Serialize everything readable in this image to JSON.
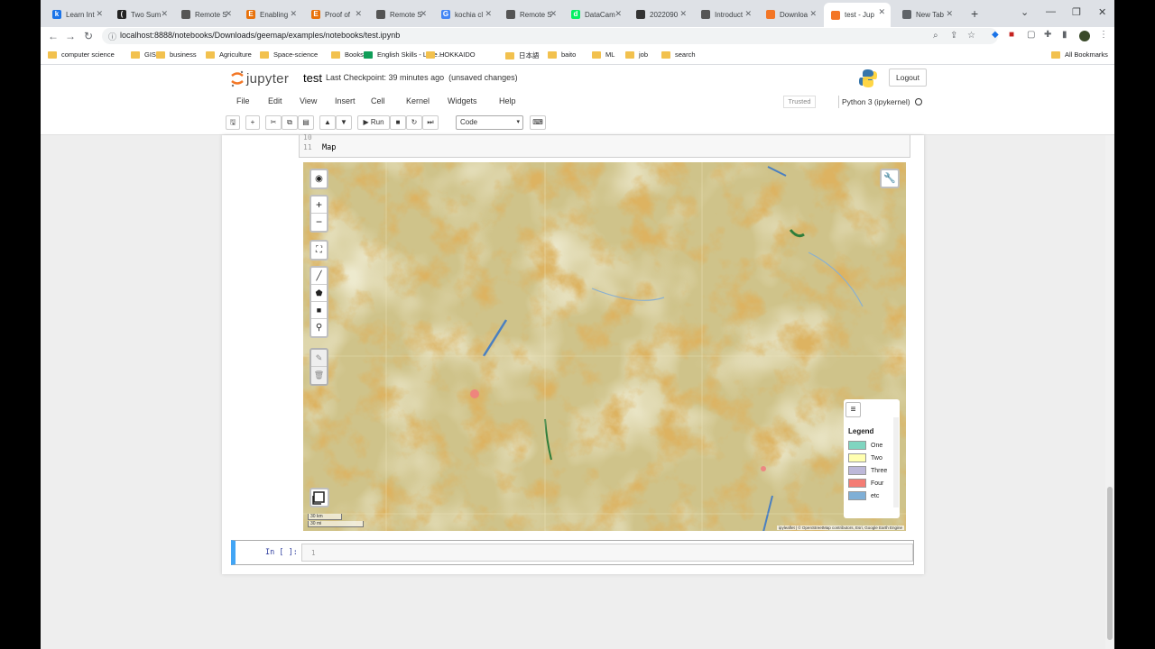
{
  "tabs": [
    {
      "label": "Learn Int",
      "color": "#1a73e8",
      "glyph": "k"
    },
    {
      "label": "Two Sum",
      "color": "#222222",
      "glyph": "("
    },
    {
      "label": "Remote S",
      "color": "#555555",
      "glyph": ""
    },
    {
      "label": "Enabling",
      "color": "#e8710a",
      "glyph": "E"
    },
    {
      "label": "Proof of",
      "color": "#e8710a",
      "glyph": "E"
    },
    {
      "label": "Remote S",
      "color": "#555555",
      "glyph": ""
    },
    {
      "label": "kochia cl",
      "color": "#4285f4",
      "glyph": "G"
    },
    {
      "label": "Remote S",
      "color": "#555555",
      "glyph": ""
    },
    {
      "label": "DataCam",
      "color": "#03ef62",
      "glyph": "d"
    },
    {
      "label": "2022090",
      "color": "#333333",
      "glyph": ""
    },
    {
      "label": "Introduct",
      "color": "#555555",
      "glyph": ""
    },
    {
      "label": "Downloa",
      "color": "#f37626",
      "glyph": ""
    },
    {
      "label": "test - Jup",
      "color": "#f37626",
      "glyph": ""
    },
    {
      "label": "New Tab",
      "color": "#5f6368",
      "glyph": ""
    }
  ],
  "url": "localhost:8888/notebooks/Downloads/geemap/examples/notebooks/test.ipynb",
  "bookmarks": [
    "computer science",
    "GIS",
    "business",
    "Agriculture",
    "Space-science",
    "Books",
    "English Skills - Liste...",
    "HOKKAIDO",
    "日本語",
    "baito",
    "ML",
    "job",
    "search"
  ],
  "all_bookmarks": "All Bookmarks",
  "jupyter": {
    "logo_word": "jupyter",
    "notebook_name": "test",
    "checkpoint": "Last Checkpoint: 39 minutes ago",
    "unsaved": "(unsaved changes)",
    "logout": "Logout",
    "menu": [
      "File",
      "Edit",
      "View",
      "Insert",
      "Cell",
      "Kernel",
      "Widgets",
      "Help"
    ],
    "trusted": "Trusted",
    "kernel": "Python 3 (ipykernel)",
    "run_label": "Run",
    "cell_type": "Code"
  },
  "code_lines": [
    {
      "num": "10",
      "text": ""
    },
    {
      "num": "11",
      "text": "Map"
    }
  ],
  "map": {
    "legend_title": "Legend",
    "legend": [
      {
        "label": "One",
        "color": "#7fd5c0"
      },
      {
        "label": "Two",
        "color": "#ffffb0"
      },
      {
        "label": "Three",
        "color": "#bdb8d9"
      },
      {
        "label": "Four",
        "color": "#f47c74"
      },
      {
        "label": "etc",
        "color": "#7fafd6"
      }
    ],
    "scale_km": "30 km",
    "scale_mi": "30 mi",
    "attribution": "ipyleaflet | © OpenStreetMap contributors, Esri, Google Earth Engine"
  },
  "next_cell": {
    "prompt": "In [ ]:",
    "line": "1"
  }
}
